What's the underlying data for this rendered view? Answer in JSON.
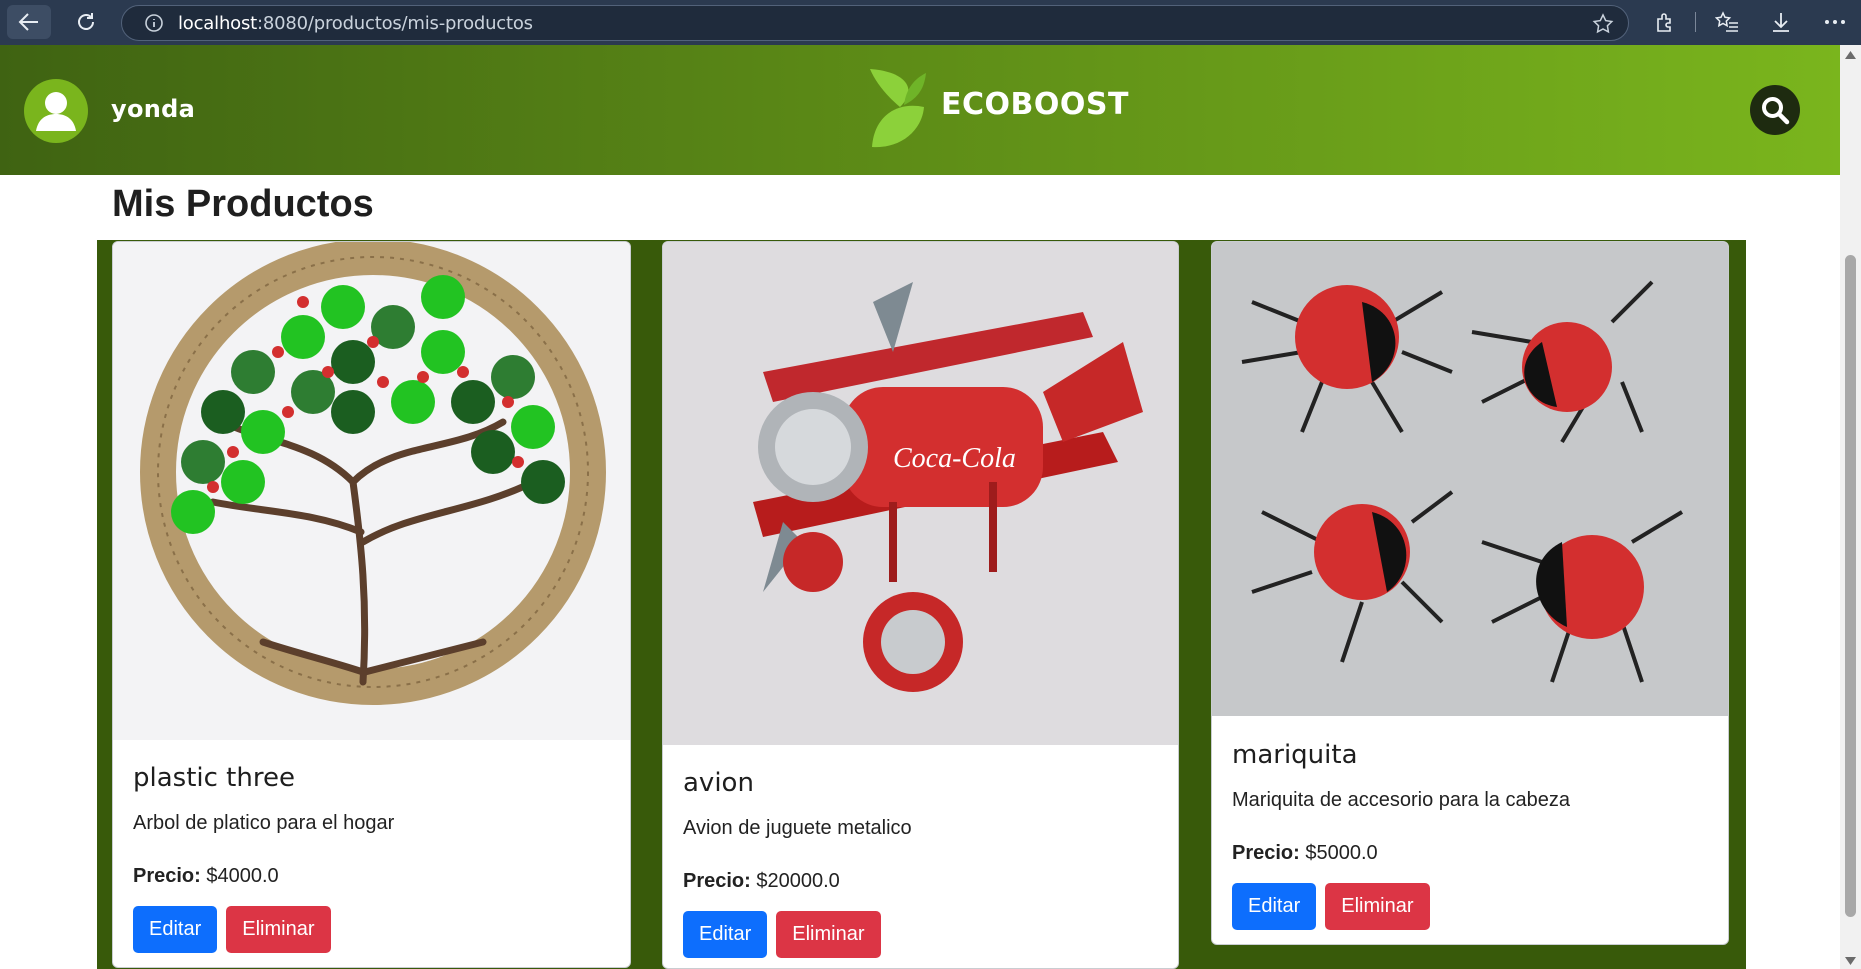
{
  "browser": {
    "url_host": "localhost",
    "url_path": ":8080/productos/mis-productos"
  },
  "header": {
    "username": "yonda",
    "brand": "ECOBOOST",
    "colors": {
      "gradient_start": "#3f6312",
      "gradient_end": "#7ab51d",
      "search_button": "#1e2b10"
    }
  },
  "page": {
    "title": "Mis Productos"
  },
  "labels": {
    "price_label": "Precio:",
    "edit": "Editar",
    "delete": "Eliminar"
  },
  "products": [
    {
      "name": "plastic three",
      "description": "Arbol de platico para el hogar",
      "price": "$4000.0",
      "image": "bottle-cap-tree-image"
    },
    {
      "name": "avion",
      "description": "Avion de juguete metalico",
      "price": "$20000.0",
      "image": "can-airplane-image"
    },
    {
      "name": "mariquita",
      "description": "Mariquita de accesorio para la cabeza",
      "price": "$5000.0",
      "image": "bottle-cap-ladybugs-image"
    }
  ],
  "icons": [
    "back-arrow-icon",
    "reload-icon",
    "site-info-icon",
    "favorite-star-icon",
    "extensions-icon",
    "favorites-list-icon",
    "downloads-icon",
    "more-menu-icon",
    "user-avatar-icon",
    "leaf-logo-icon",
    "search-icon"
  ]
}
